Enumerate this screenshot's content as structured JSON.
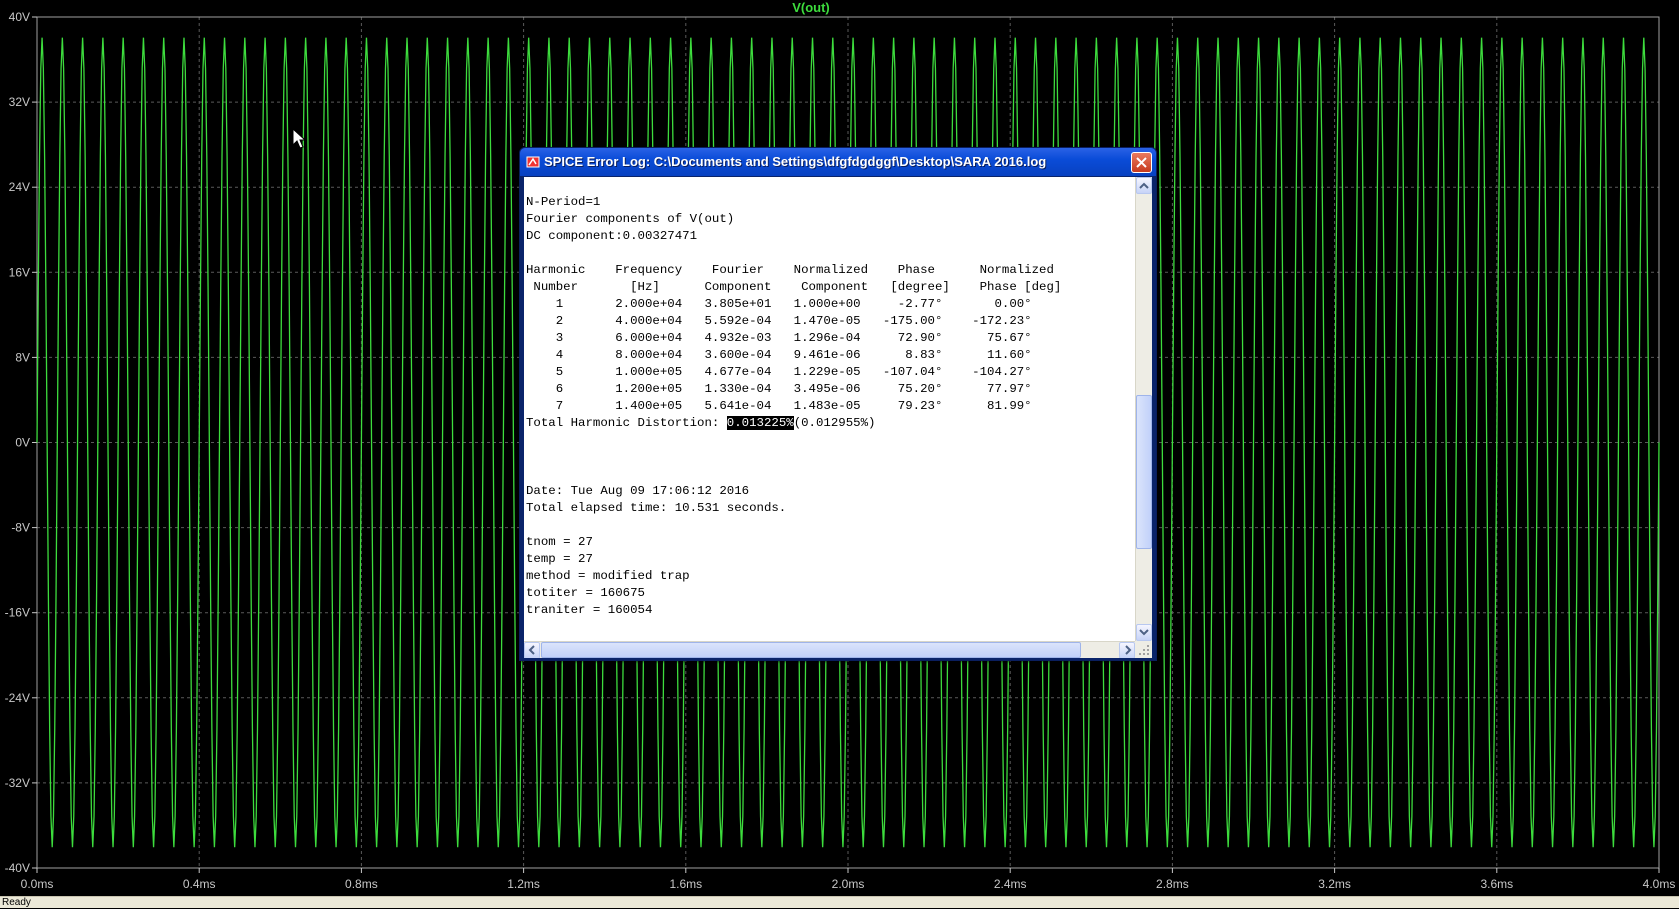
{
  "plot": {
    "trace_name": "V(out)",
    "trace_color": "#3ddc3d",
    "y_ticks": [
      "40V",
      "32V",
      "24V",
      "16V",
      "8V",
      "0V",
      "-8V",
      "-16V",
      "-24V",
      "-32V",
      "-40V"
    ],
    "x_ticks": [
      "0.0ms",
      "0.4ms",
      "0.8ms",
      "1.2ms",
      "1.6ms",
      "2.0ms",
      "2.4ms",
      "2.8ms",
      "3.2ms",
      "3.6ms",
      "4.0ms"
    ],
    "grid_color": "#5a5a5a",
    "background": "#000000"
  },
  "chart_data": {
    "type": "line",
    "title": "V(out)",
    "xlabel": "",
    "ylabel": "",
    "xlim": [
      0,
      4.0
    ],
    "x_unit": "ms",
    "ylim": [
      -40,
      40
    ],
    "y_unit": "V",
    "grid": true,
    "series": [
      {
        "name": "V(out)",
        "frequency_hz": 20000,
        "amplitude_v": 38.05,
        "offset_v": 0.00327471
      }
    ]
  },
  "dialog": {
    "title": "SPICE Error Log: C:\\Documents and Settings\\dfgfdgdggf\\Desktop\\SARA 2016.log",
    "lines": [
      "",
      "N-Period=1",
      "Fourier components of V(out)",
      "DC component:0.00327471",
      "",
      "Harmonic    Frequency    Fourier    Normalized    Phase      Normalized",
      " Number       [Hz]      Component    Component   [degree]    Phase [deg]",
      "    1       2.000e+04   3.805e+01   1.000e+00     -2.77°       0.00°",
      "    2       4.000e+04   5.592e-04   1.470e-05   -175.00°    -172.23°",
      "    3       6.000e+04   4.932e-03   1.296e-04     72.90°      75.67°",
      "    4       8.000e+04   3.600e-04   9.461e-06      8.83°      11.60°",
      "    5       1.000e+05   4.677e-04   1.229e-05   -107.04°    -104.27°",
      "    6       1.200e+05   1.330e-04   3.495e-06     75.20°      77.97°",
      "    7       1.400e+05   5.641e-04   1.483e-05     79.23°      81.99°"
    ],
    "thd_label": "Total Harmonic Distortion: ",
    "thd_value": "0.013225%",
    "thd_alt": "(0.012955%)",
    "lines_after": [
      "",
      "",
      "",
      "Date: Tue Aug 09 17:06:12 2016",
      "Total elapsed time: 10.531 seconds.",
      "",
      "tnom = 27",
      "temp = 27",
      "method = modified trap",
      "totiter = 160675",
      "traniter = 160054"
    ]
  },
  "status": {
    "text": "Ready"
  }
}
